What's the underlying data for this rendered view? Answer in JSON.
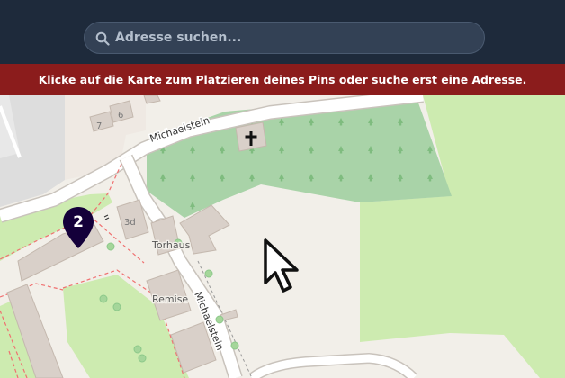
{
  "search": {
    "placeholder": "Adresse suchen..."
  },
  "banner": {
    "text": "Klicke auf die Karte zum Platzieren deines Pins oder suche erst eine Adresse."
  },
  "map": {
    "street_labels": [
      "Michaelstein",
      "Michaelstein"
    ],
    "place_labels": [
      "Torhaus",
      "Remise"
    ],
    "house_numbers": [
      "7",
      "6",
      "3d"
    ],
    "pin_number": "2"
  },
  "colors": {
    "header_bg": "#1e2a3b",
    "banner_bg": "#8b1c1c",
    "pin": "#14003a",
    "cemetery": "#a9d3a8",
    "grass": "#cdebb0",
    "building": "#d9d0c9"
  },
  "icons": [
    "search-icon",
    "map-pin-icon",
    "cross-icon",
    "cursor-arrow-icon"
  ]
}
